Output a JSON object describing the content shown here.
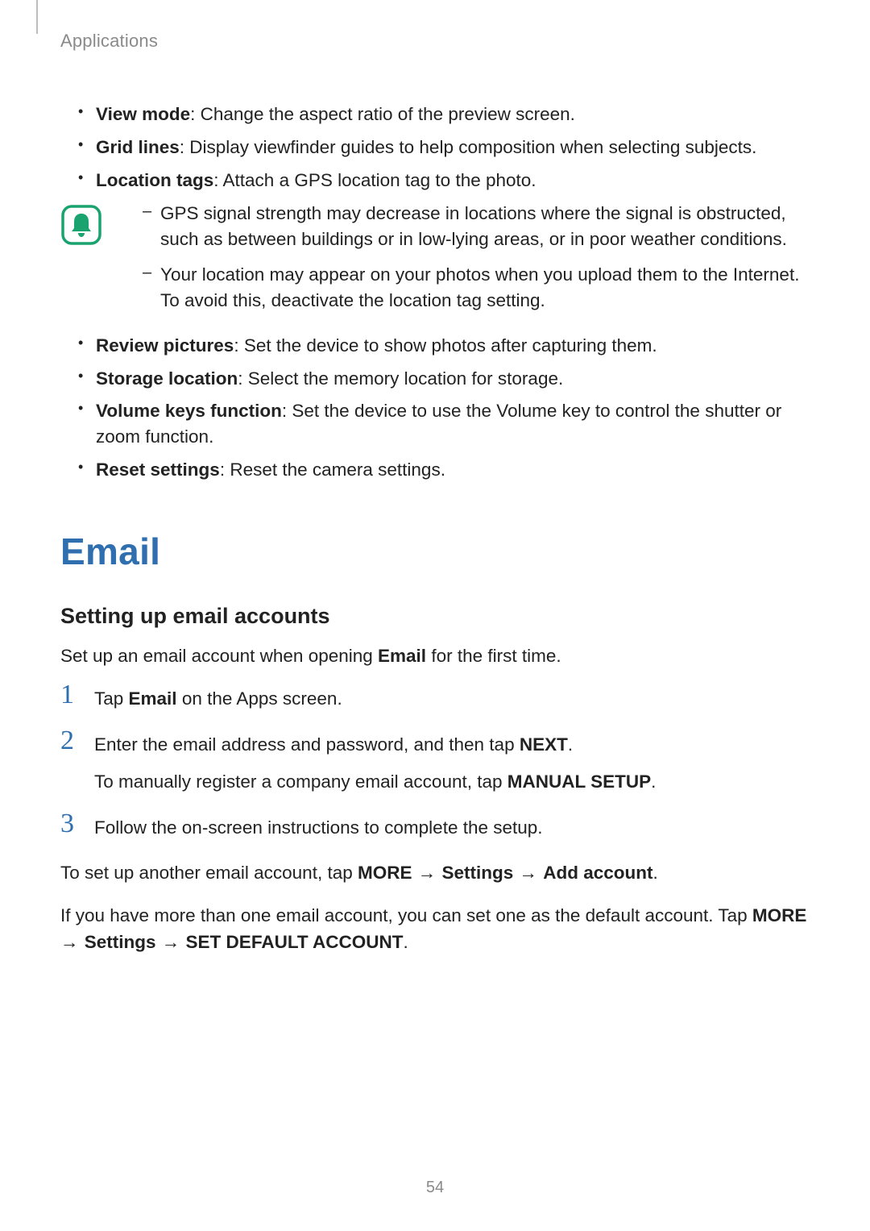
{
  "header": {
    "title": "Applications"
  },
  "cameraList1": [
    {
      "term": "View mode",
      "desc": ": Change the aspect ratio of the preview screen."
    },
    {
      "term": "Grid lines",
      "desc": ": Display viewfinder guides to help composition when selecting subjects."
    },
    {
      "term": "Location tags",
      "desc": ": Attach a GPS location tag to the photo."
    }
  ],
  "noteItems": [
    "GPS signal strength may decrease in locations where the signal is obstructed, such as between buildings or in low-lying areas, or in poor weather conditions.",
    "Your location may appear on your photos when you upload them to the Internet. To avoid this, deactivate the location tag setting."
  ],
  "cameraList2": [
    {
      "term": "Review pictures",
      "desc": ": Set the device to show photos after capturing them."
    },
    {
      "term": "Storage location",
      "desc": ": Select the memory location for storage."
    },
    {
      "term": "Volume keys function",
      "desc": ": Set the device to use the Volume key to control the shutter or zoom function."
    },
    {
      "term": "Reset settings",
      "desc": ": Reset the camera settings."
    }
  ],
  "section": {
    "heading": "Email",
    "subheading": "Setting up email accounts",
    "intro_pre": "Set up an email account when opening ",
    "intro_bold": "Email",
    "intro_post": " for the first time."
  },
  "steps": [
    {
      "num": "1",
      "line_parts": [
        {
          "t": "Tap "
        },
        {
          "t": "Email",
          "b": true
        },
        {
          "t": " on the Apps screen."
        }
      ]
    },
    {
      "num": "2",
      "line_parts": [
        {
          "t": "Enter the email address and password, and then tap "
        },
        {
          "t": "NEXT",
          "b": true
        },
        {
          "t": "."
        }
      ],
      "sub_parts": [
        {
          "t": "To manually register a company email account, tap "
        },
        {
          "t": "MANUAL SETUP",
          "b": true
        },
        {
          "t": "."
        }
      ]
    },
    {
      "num": "3",
      "line_parts": [
        {
          "t": "Follow the on-screen instructions to complete the setup."
        }
      ]
    }
  ],
  "para_another": [
    {
      "t": "To set up another email account, tap "
    },
    {
      "t": "MORE",
      "b": true
    },
    {
      "t": " → ",
      "arrow": true
    },
    {
      "t": "Settings",
      "b": true
    },
    {
      "t": " → ",
      "arrow": true
    },
    {
      "t": "Add account",
      "b": true
    },
    {
      "t": "."
    }
  ],
  "para_default": [
    {
      "t": "If you have more than one email account, you can set one as the default account. Tap "
    },
    {
      "t": "MORE",
      "b": true
    },
    {
      "t": " → ",
      "arrow": true
    },
    {
      "t": "Settings",
      "b": true
    },
    {
      "t": " → ",
      "arrow": true
    },
    {
      "t": "SET DEFAULT ACCOUNT",
      "b": true
    },
    {
      "t": "."
    }
  ],
  "pageNumber": "54"
}
